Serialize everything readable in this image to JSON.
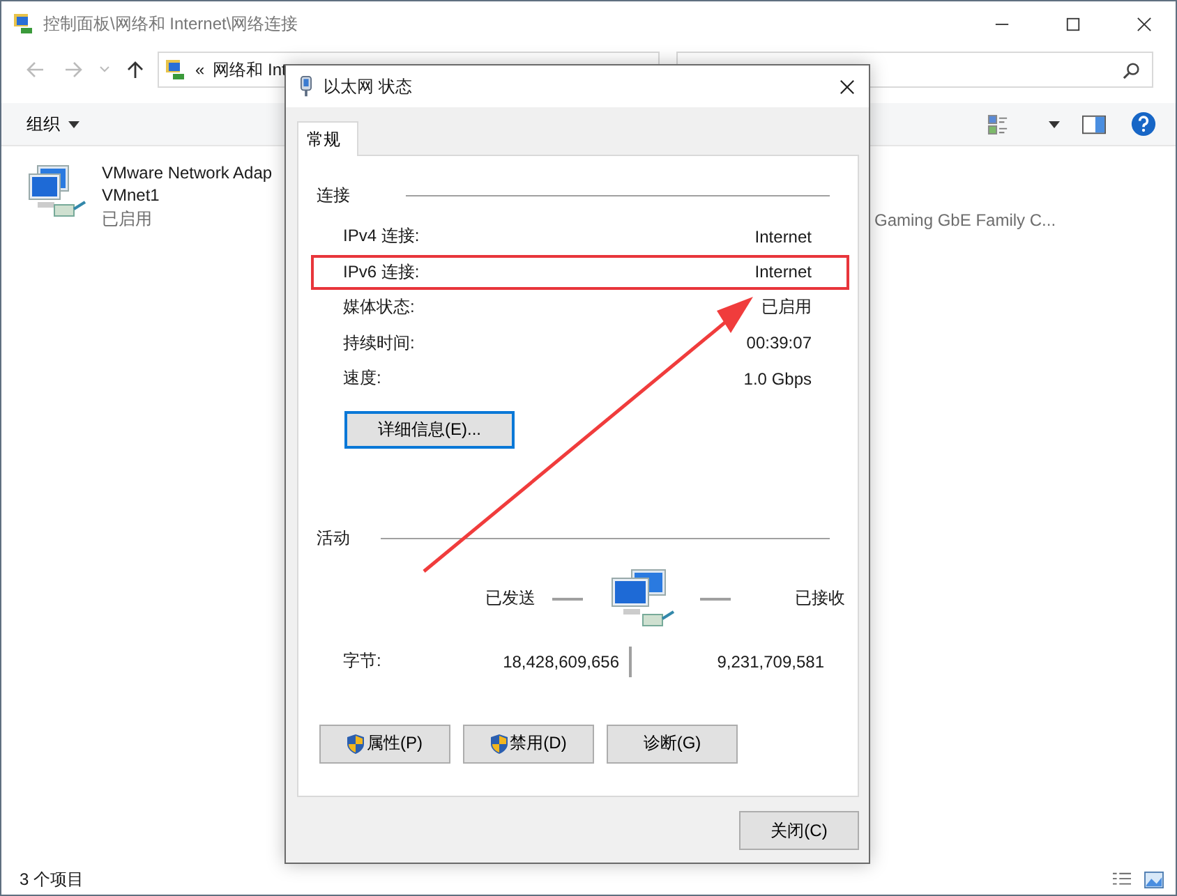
{
  "window": {
    "title": "控制面板\\网络和 Internet\\网络连接"
  },
  "address_bar": {
    "chevron": "«",
    "path": "网络和 Int"
  },
  "toolbar": {
    "organize": "组织"
  },
  "items": [
    {
      "name": "VMware Network Adap",
      "device": "VMnet1",
      "status": "已启用"
    },
    {
      "device": "Gaming GbE Family C..."
    }
  ],
  "status_bar": {
    "count": "3 个项目"
  },
  "dialog": {
    "title": "以太网 状态",
    "tabs": [
      {
        "label": "常规",
        "selected": true
      }
    ],
    "connection": {
      "heading": "连接",
      "rows": [
        {
          "label": "IPv4 连接:",
          "value": "Internet",
          "highlighted": false
        },
        {
          "label": "IPv6 连接:",
          "value": "Internet",
          "highlighted": true
        },
        {
          "label": "媒体状态:",
          "value": "已启用",
          "highlighted": false
        },
        {
          "label": "持续时间:",
          "value": "00:39:07",
          "highlighted": false
        },
        {
          "label": "速度:",
          "value": "1.0 Gbps",
          "highlighted": false
        }
      ]
    },
    "details_button": "详细信息(E)...",
    "activity": {
      "heading": "活动",
      "sent_label": "已发送",
      "received_label": "已接收",
      "bytes_label": "字节:",
      "bytes_sent": "18,428,609,656",
      "bytes_received": "9,231,709,581"
    },
    "buttons": [
      {
        "label": "属性(P)",
        "shield": true
      },
      {
        "label": "禁用(D)",
        "shield": true
      },
      {
        "label": "诊断(G)",
        "shield": false
      }
    ],
    "close_button": "关闭(C)"
  }
}
